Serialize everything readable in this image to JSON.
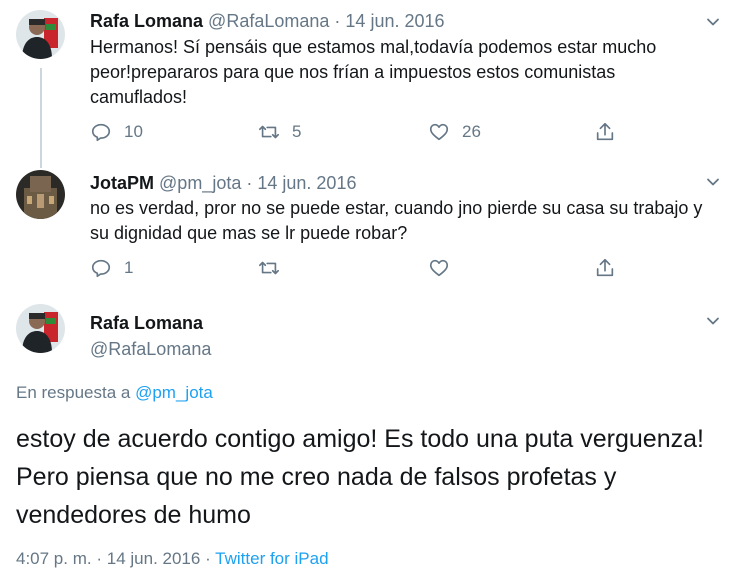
{
  "tweets": [
    {
      "name": "Rafa Lomana",
      "handle": "@RafaLomana",
      "separator": "·",
      "date": "14 jun. 2016",
      "text": "Hermanos! Sí pensáis que estamos mal,todavía podemos estar mucho peor!prepararos para que nos frían a impuestos estos comunistas camuflados!",
      "replies": "10",
      "retweets": "5",
      "likes": "26"
    },
    {
      "name": "JotaPM",
      "handle": "@pm_jota",
      "separator": "·",
      "date": "14 jun. 2016",
      "text": "no es verdad, pror no se puede estar, cuando jno pierde su casa su trabajo y su dignidad que mas se lr puede robar?",
      "replies": "1",
      "retweets": "",
      "likes": ""
    }
  ],
  "main_tweet": {
    "name": "Rafa Lomana",
    "handle": "@RafaLomana",
    "reply_prefix": "En respuesta a",
    "reply_mention": "@pm_jota",
    "text": "estoy de acuerdo contigo amigo! Es todo una puta verguenza! Pero piensa que no me creo nada de falsos profetas y vendedores de humo",
    "time": "4:07 p. m.",
    "separator": "·",
    "date": "14 jun. 2016",
    "separator2": "·",
    "source": "Twitter for iPad"
  },
  "icons": {
    "reply": "reply-icon",
    "retweet": "retweet-icon",
    "like": "heart-icon",
    "share": "share-icon",
    "menu": "chevron-down-icon"
  },
  "colors": {
    "text": "#14171a",
    "secondary": "#657786",
    "link": "#1da1f2",
    "thread_line": "#ccd6dd"
  }
}
